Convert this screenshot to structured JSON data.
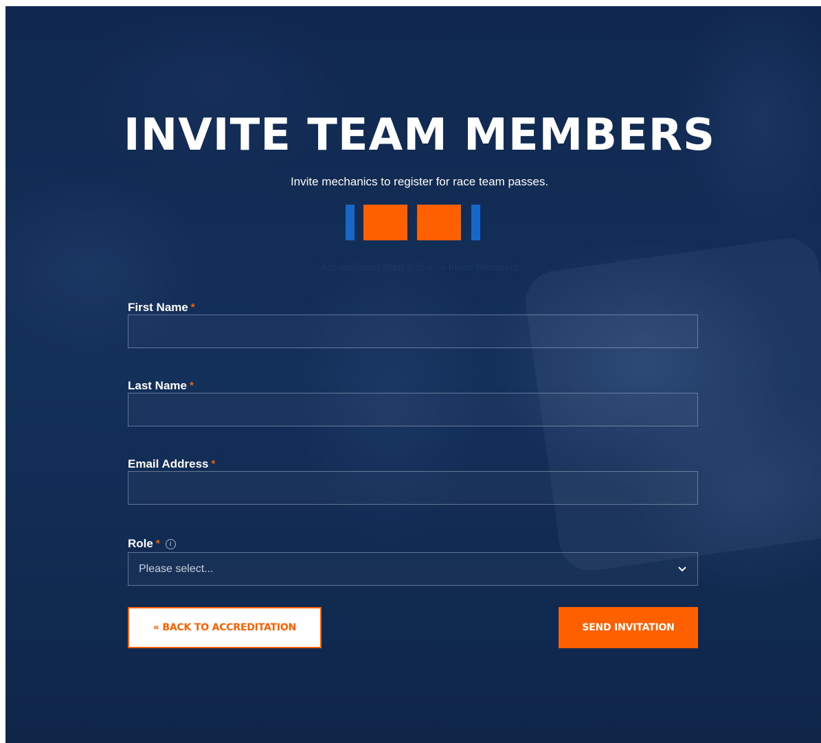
{
  "header": {
    "title": "INVITE TEAM MEMBERS",
    "subtitle": "Invite mechanics to register for race team passes."
  },
  "progress": {
    "caption": "Accreditation Step 2 of 4 — Invite Members",
    "colors": {
      "active": "#fe6000",
      "inactive": "#1767c6"
    }
  },
  "form": {
    "first_name": {
      "label": "First Name",
      "required": "*",
      "value": "",
      "placeholder": ""
    },
    "last_name": {
      "label": "Last Name",
      "required": "*",
      "value": "",
      "placeholder": ""
    },
    "email": {
      "label": "Email Address",
      "required": "*",
      "value": "",
      "placeholder": ""
    },
    "role": {
      "label": "Role",
      "required": "*",
      "info_icon": "info-icon",
      "selected": "Please select..."
    }
  },
  "actions": {
    "back_label": "« BACK TO ACCREDITATION",
    "send_label": "SEND INVITATION"
  },
  "theme": {
    "background": "#112a52",
    "accent": "#fe6000"
  }
}
